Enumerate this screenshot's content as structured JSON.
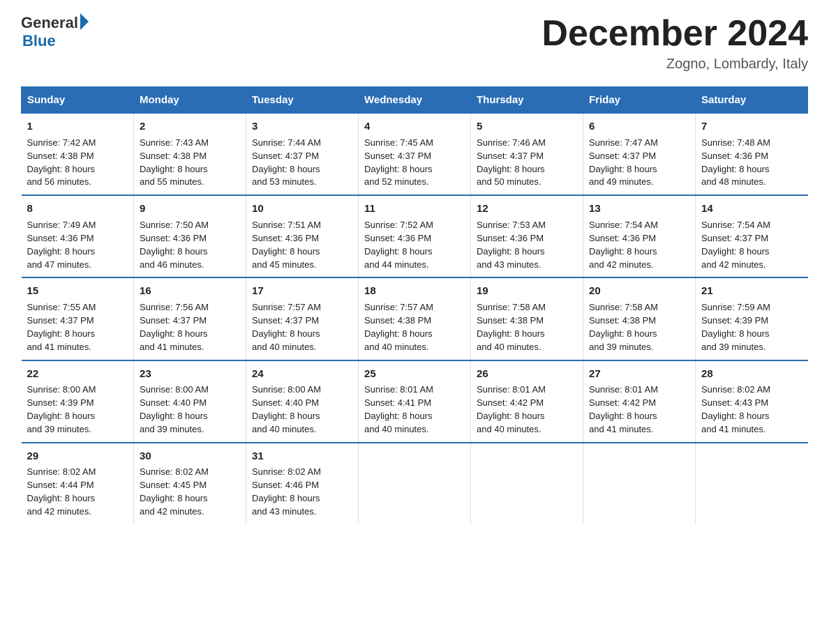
{
  "logo": {
    "general": "General",
    "blue": "Blue"
  },
  "title": "December 2024",
  "subtitle": "Zogno, Lombardy, Italy",
  "days_of_week": [
    "Sunday",
    "Monday",
    "Tuesday",
    "Wednesday",
    "Thursday",
    "Friday",
    "Saturday"
  ],
  "weeks": [
    [
      {
        "date": "1",
        "sunrise": "7:42 AM",
        "sunset": "4:38 PM",
        "daylight": "8 hours and 56 minutes."
      },
      {
        "date": "2",
        "sunrise": "7:43 AM",
        "sunset": "4:38 PM",
        "daylight": "8 hours and 55 minutes."
      },
      {
        "date": "3",
        "sunrise": "7:44 AM",
        "sunset": "4:37 PM",
        "daylight": "8 hours and 53 minutes."
      },
      {
        "date": "4",
        "sunrise": "7:45 AM",
        "sunset": "4:37 PM",
        "daylight": "8 hours and 52 minutes."
      },
      {
        "date": "5",
        "sunrise": "7:46 AM",
        "sunset": "4:37 PM",
        "daylight": "8 hours and 50 minutes."
      },
      {
        "date": "6",
        "sunrise": "7:47 AM",
        "sunset": "4:37 PM",
        "daylight": "8 hours and 49 minutes."
      },
      {
        "date": "7",
        "sunrise": "7:48 AM",
        "sunset": "4:36 PM",
        "daylight": "8 hours and 48 minutes."
      }
    ],
    [
      {
        "date": "8",
        "sunrise": "7:49 AM",
        "sunset": "4:36 PM",
        "daylight": "8 hours and 47 minutes."
      },
      {
        "date": "9",
        "sunrise": "7:50 AM",
        "sunset": "4:36 PM",
        "daylight": "8 hours and 46 minutes."
      },
      {
        "date": "10",
        "sunrise": "7:51 AM",
        "sunset": "4:36 PM",
        "daylight": "8 hours and 45 minutes."
      },
      {
        "date": "11",
        "sunrise": "7:52 AM",
        "sunset": "4:36 PM",
        "daylight": "8 hours and 44 minutes."
      },
      {
        "date": "12",
        "sunrise": "7:53 AM",
        "sunset": "4:36 PM",
        "daylight": "8 hours and 43 minutes."
      },
      {
        "date": "13",
        "sunrise": "7:54 AM",
        "sunset": "4:36 PM",
        "daylight": "8 hours and 42 minutes."
      },
      {
        "date": "14",
        "sunrise": "7:54 AM",
        "sunset": "4:37 PM",
        "daylight": "8 hours and 42 minutes."
      }
    ],
    [
      {
        "date": "15",
        "sunrise": "7:55 AM",
        "sunset": "4:37 PM",
        "daylight": "8 hours and 41 minutes."
      },
      {
        "date": "16",
        "sunrise": "7:56 AM",
        "sunset": "4:37 PM",
        "daylight": "8 hours and 41 minutes."
      },
      {
        "date": "17",
        "sunrise": "7:57 AM",
        "sunset": "4:37 PM",
        "daylight": "8 hours and 40 minutes."
      },
      {
        "date": "18",
        "sunrise": "7:57 AM",
        "sunset": "4:38 PM",
        "daylight": "8 hours and 40 minutes."
      },
      {
        "date": "19",
        "sunrise": "7:58 AM",
        "sunset": "4:38 PM",
        "daylight": "8 hours and 40 minutes."
      },
      {
        "date": "20",
        "sunrise": "7:58 AM",
        "sunset": "4:38 PM",
        "daylight": "8 hours and 39 minutes."
      },
      {
        "date": "21",
        "sunrise": "7:59 AM",
        "sunset": "4:39 PM",
        "daylight": "8 hours and 39 minutes."
      }
    ],
    [
      {
        "date": "22",
        "sunrise": "8:00 AM",
        "sunset": "4:39 PM",
        "daylight": "8 hours and 39 minutes."
      },
      {
        "date": "23",
        "sunrise": "8:00 AM",
        "sunset": "4:40 PM",
        "daylight": "8 hours and 39 minutes."
      },
      {
        "date": "24",
        "sunrise": "8:00 AM",
        "sunset": "4:40 PM",
        "daylight": "8 hours and 40 minutes."
      },
      {
        "date": "25",
        "sunrise": "8:01 AM",
        "sunset": "4:41 PM",
        "daylight": "8 hours and 40 minutes."
      },
      {
        "date": "26",
        "sunrise": "8:01 AM",
        "sunset": "4:42 PM",
        "daylight": "8 hours and 40 minutes."
      },
      {
        "date": "27",
        "sunrise": "8:01 AM",
        "sunset": "4:42 PM",
        "daylight": "8 hours and 41 minutes."
      },
      {
        "date": "28",
        "sunrise": "8:02 AM",
        "sunset": "4:43 PM",
        "daylight": "8 hours and 41 minutes."
      }
    ],
    [
      {
        "date": "29",
        "sunrise": "8:02 AM",
        "sunset": "4:44 PM",
        "daylight": "8 hours and 42 minutes."
      },
      {
        "date": "30",
        "sunrise": "8:02 AM",
        "sunset": "4:45 PM",
        "daylight": "8 hours and 42 minutes."
      },
      {
        "date": "31",
        "sunrise": "8:02 AM",
        "sunset": "4:46 PM",
        "daylight": "8 hours and 43 minutes."
      },
      {
        "date": "",
        "sunrise": "",
        "sunset": "",
        "daylight": ""
      },
      {
        "date": "",
        "sunrise": "",
        "sunset": "",
        "daylight": ""
      },
      {
        "date": "",
        "sunrise": "",
        "sunset": "",
        "daylight": ""
      },
      {
        "date": "",
        "sunrise": "",
        "sunset": "",
        "daylight": ""
      }
    ]
  ],
  "labels": {
    "sunrise": "Sunrise:",
    "sunset": "Sunset:",
    "daylight": "Daylight:"
  }
}
